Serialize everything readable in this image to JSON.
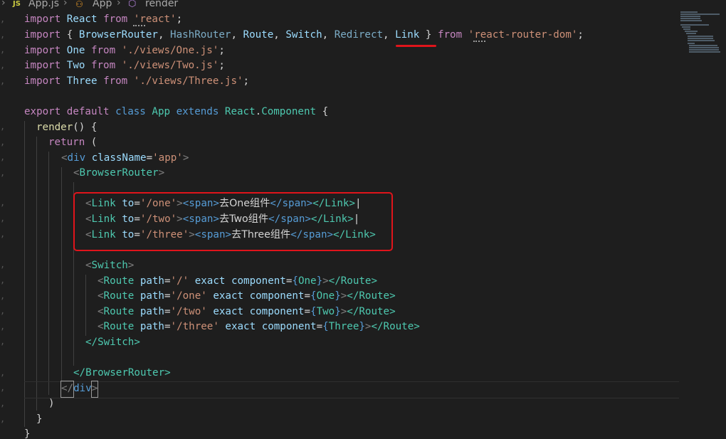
{
  "breadcrumb": {
    "file_badge": "JS",
    "file": "App.js",
    "class": "App",
    "method": "render"
  },
  "code": {
    "l1": {
      "k1": "import",
      "n1": "React",
      "k2": "from",
      "s1": "'react'",
      "p": ";"
    },
    "l2": {
      "k1": "import",
      "p1": "{",
      "n1": "BrowserRouter",
      "n2": "HashRouter",
      "n3": "Route",
      "n4": "Switch",
      "n5": "Redirect",
      "n6": "Link",
      "p2": "}",
      "k2": "from",
      "s1": "'react-router-dom'",
      "p3": ";",
      "comma": ","
    },
    "l3": {
      "k1": "import",
      "n1": "One",
      "k2": "from",
      "s1": "'./views/One.js'",
      "p": ";"
    },
    "l4": {
      "k1": "import",
      "n1": "Two",
      "k2": "from",
      "s1": "'./views/Two.js'",
      "p": ";"
    },
    "l5": {
      "k1": "import",
      "n1": "Three",
      "k2": "from",
      "s1": "'./views/Three.js'",
      "p": ";"
    },
    "l7": {
      "k1": "export",
      "k2": "default",
      "k3": "class",
      "n1": "App",
      "k4": "extends",
      "n2": "React",
      "dot": ".",
      "n3": "Component",
      "p": "{"
    },
    "l8": {
      "f": "render",
      "p": "() {"
    },
    "l9": {
      "k": "return",
      "p": "("
    },
    "l10": {
      "lt": "<",
      "tag": "div",
      "attr": "className",
      "eq": "=",
      "val": "'app'",
      "gt": ">"
    },
    "l11": {
      "lt": "<",
      "tag": "BrowserRouter",
      "gt": ">"
    },
    "l13": {
      "lt": "<",
      "tag": "Link",
      "attr": "to",
      "eq": "=",
      "val": "'/one'",
      "gt": ">",
      "sp_open": "<span>",
      "text": "去One组件",
      "sp_close": "</span>",
      "close": "</Link>",
      "bar": "|"
    },
    "l14": {
      "lt": "<",
      "tag": "Link",
      "attr": "to",
      "eq": "=",
      "val": "'/two'",
      "gt": ">",
      "sp_open": "<span>",
      "text": "去Two组件",
      "sp_close": "</span>",
      "close": "</Link>",
      "bar": "|"
    },
    "l15": {
      "lt": "<",
      "tag": "Link",
      "attr": "to",
      "eq": "=",
      "val": "'/three'",
      "gt": ">",
      "sp_open": "<span>",
      "text": "去Three组件",
      "sp_close": "</span>",
      "close": "</Link>"
    },
    "l17": {
      "lt": "<",
      "tag": "Switch",
      "gt": ">"
    },
    "l18": {
      "lt": "<",
      "tag": "Route",
      "a1": "path",
      "eq": "=",
      "v1": "'/'",
      "a2": "exact",
      "a3": "component",
      "b1": "{",
      "c": "One",
      "b2": "}",
      "gt": ">",
      "close": "</Route>"
    },
    "l19": {
      "lt": "<",
      "tag": "Route",
      "a1": "path",
      "eq": "=",
      "v1": "'/one'",
      "a2": "exact",
      "a3": "component",
      "b1": "{",
      "c": "One",
      "b2": "}",
      "gt": ">",
      "close": "</Route>"
    },
    "l20": {
      "lt": "<",
      "tag": "Route",
      "a1": "path",
      "eq": "=",
      "v1": "'/two'",
      "a2": "exact",
      "a3": "component",
      "b1": "{",
      "c": "Two",
      "b2": "}",
      "gt": ">",
      "close": "</Route>"
    },
    "l21": {
      "lt": "<",
      "tag": "Route",
      "a1": "path",
      "eq": "=",
      "v1": "'/three'",
      "a2": "exact",
      "a3": "component",
      "b1": "{",
      "c": "Three",
      "b2": "}",
      "gt": ">",
      "close": "</Route>"
    },
    "l22": {
      "close": "</Switch>"
    },
    "l24": {
      "close": "</BrowserRouter>"
    },
    "l25": {
      "close1": "</",
      "tag": "div",
      "close2": ">"
    },
    "l26": {
      "p": ")"
    },
    "l27": {
      "p": "}"
    },
    "l28": {
      "p": "}"
    }
  },
  "colors": {
    "background": "#1e1e1e",
    "highlight": "#e0141b"
  }
}
